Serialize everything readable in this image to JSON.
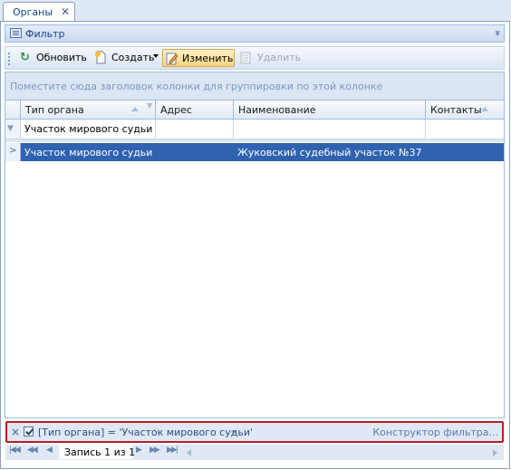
{
  "tab": {
    "title": "Органы",
    "close": "✕"
  },
  "filter_panel": {
    "label": "Фильтр",
    "collapse": "»"
  },
  "toolbar": {
    "refresh": "Обновить",
    "create": "Создать",
    "edit": "Изменить",
    "delete": "Удалить"
  },
  "grid": {
    "group_hint": "Поместите сюда заголовок колонки для группировки по этой колонке",
    "columns": [
      "Тип органа",
      "Адрес",
      "Наименование",
      "Контакты"
    ],
    "auto_filter": [
      "Участок мирового судьи",
      "",
      "",
      ""
    ],
    "rows": [
      [
        "Участок мирового судьи",
        "",
        "Жуковский судебный участок №37",
        ""
      ]
    ]
  },
  "filter": {
    "expression": "[Тип органа] = 'Участок мирового судьи'",
    "builder": "Конструктор фильтра...",
    "enabled": true
  },
  "navigator": {
    "record": "Запись 1 из 1"
  },
  "colors": {
    "selection": "#2f62b0",
    "accent": "#b81e26",
    "header_bg": "#dfe9f5"
  }
}
